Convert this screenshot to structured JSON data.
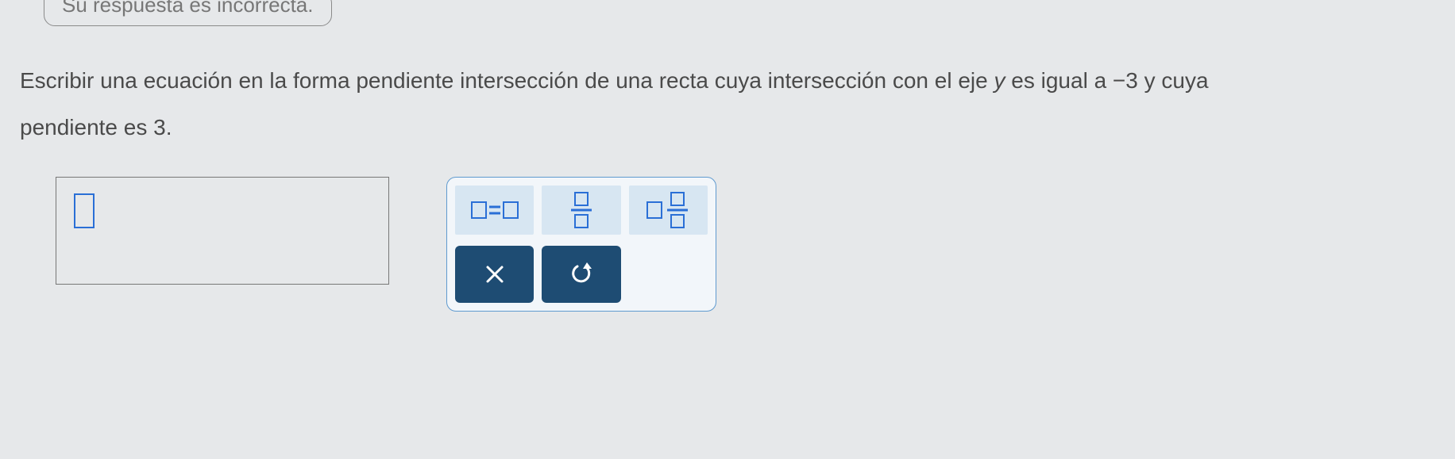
{
  "feedback": {
    "message": "Su respuesta es incorrecta."
  },
  "problem": {
    "line1_prefix": "Escribir una ecuación en la forma pendiente intersección de una recta cuya intersección con el eje ",
    "y_var": "y",
    "mid": " es igual a ",
    "y_intercept": "−3",
    "suffix": " y cuya",
    "line2_prefix": "pendiente es ",
    "slope": "3",
    "period": "."
  },
  "tools": {
    "equals": "equals-template",
    "fraction": "fraction-template",
    "mixed": "mixed-number-template"
  },
  "actions": {
    "clear": "clear",
    "reset": "reset"
  }
}
